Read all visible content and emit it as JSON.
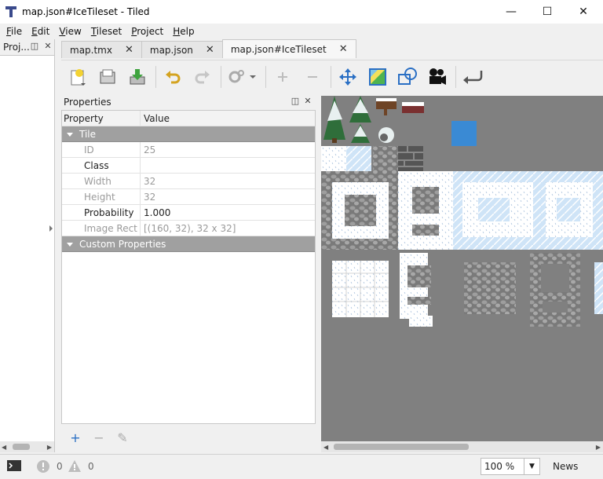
{
  "window": {
    "title": "map.json#IceTileset - Tiled",
    "controls": {
      "minimize": "—",
      "maximize": "☐",
      "close": "✕"
    }
  },
  "menu": [
    {
      "label": "File",
      "mnemonic": "F",
      "rest": "ile"
    },
    {
      "label": "Edit",
      "mnemonic": "E",
      "rest": "dit"
    },
    {
      "label": "View",
      "mnemonic": "V",
      "rest": "iew"
    },
    {
      "label": "Tileset",
      "mnemonic": "T",
      "rest": "ileset"
    },
    {
      "label": "Project",
      "mnemonic": "P",
      "rest": "roject"
    },
    {
      "label": "Help",
      "mnemonic": "H",
      "rest": "elp"
    }
  ],
  "left_dock": {
    "title": "Proj..."
  },
  "tabs": [
    {
      "label": "map.tmx",
      "close": "✕",
      "active": false
    },
    {
      "label": "map.json",
      "close": "✕",
      "active": false
    },
    {
      "label": "map.json#IceTileset",
      "close": "✕",
      "active": true
    }
  ],
  "toolbar_icons": [
    "new-tileset-icon",
    "open-icon",
    "export-icon",
    "undo-icon",
    "redo-icon",
    "settings-icon",
    "add-icon",
    "remove-icon",
    "move-icon",
    "image-icon",
    "shape-icon",
    "camera-icon",
    "return-icon"
  ],
  "properties": {
    "title": "Properties",
    "headers": {
      "property": "Property",
      "value": "Value"
    },
    "group_tile": "Tile",
    "rows": [
      {
        "name": "ID",
        "value": "25",
        "disabled": true
      },
      {
        "name": "Class",
        "value": "",
        "disabled": false
      },
      {
        "name": "Width",
        "value": "32",
        "disabled": true
      },
      {
        "name": "Height",
        "value": "32",
        "disabled": true
      },
      {
        "name": "Probability",
        "value": "1.000",
        "disabled": false
      },
      {
        "name": "Image Rect",
        "value": "[(160, 32), 32 x 32]",
        "disabled": true
      }
    ],
    "group_custom": "Custom Properties",
    "actions": {
      "add": "+",
      "remove": "−",
      "edit": "✎"
    }
  },
  "colors": {
    "tileset_background": "#808080",
    "selected_tile": "#3a8ad4",
    "snow": "#ffffff",
    "ice": "#cfe4f7",
    "stone": "#8d8d8d",
    "tree": "#2f6e3a"
  },
  "status": {
    "error_count": "0",
    "warning_count": "0",
    "zoom": "100 %",
    "news": "News"
  }
}
